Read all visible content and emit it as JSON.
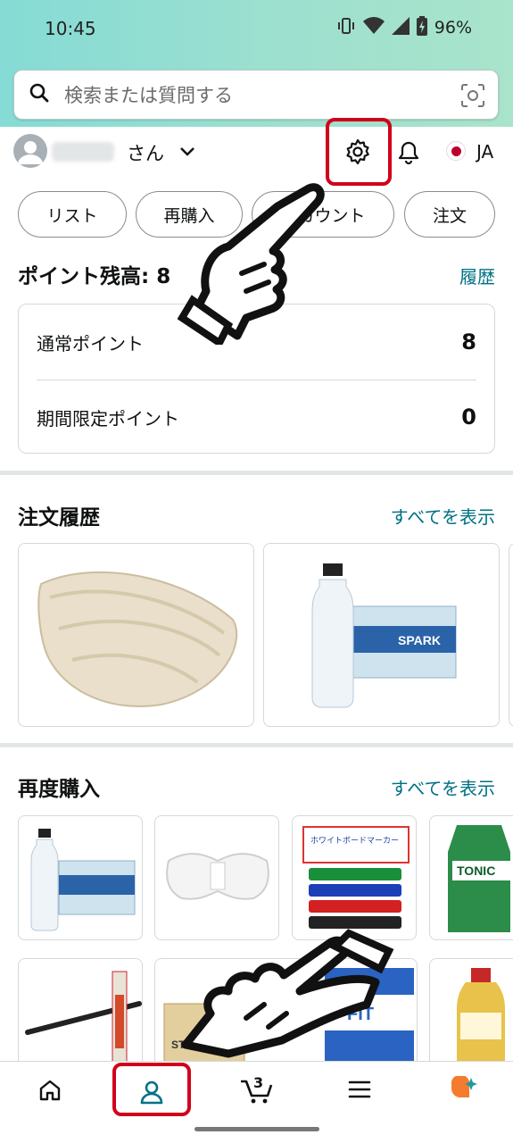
{
  "status_bar": {
    "time": "10:45",
    "battery": "96%"
  },
  "search": {
    "placeholder": "検索または質問する"
  },
  "account": {
    "suffix": "さん",
    "language": "JA"
  },
  "quick_pills": [
    {
      "label": "リスト"
    },
    {
      "label": "再購入"
    },
    {
      "label": "アカウント"
    },
    {
      "label": "注文"
    }
  ],
  "points": {
    "title": "ポイント残高: 8",
    "history_link": "履歴",
    "rows": [
      {
        "label": "通常ポイント",
        "value": "8"
      },
      {
        "label": "期間限定ポイント",
        "value": "0"
      }
    ]
  },
  "order_history": {
    "title": "注文履歴",
    "see_all": "すべてを表示"
  },
  "buy_again": {
    "title": "再度購入",
    "see_all": "すべてを表示"
  },
  "product_text": {
    "sparkling_label": "SPARK",
    "tonic_label": "TONIC",
    "marker_label": "ホワイトボードマーカー",
    "fit_label": "FIT",
    "strong_label": "STRONG"
  },
  "bottom_nav": {
    "cart_count": "3"
  },
  "colors": {
    "accent_link": "#007185",
    "highlight": "#d0021b",
    "header_gradient_start": "#85dbd5",
    "header_gradient_end": "#a9e4cb",
    "nav_active": "#007185"
  }
}
